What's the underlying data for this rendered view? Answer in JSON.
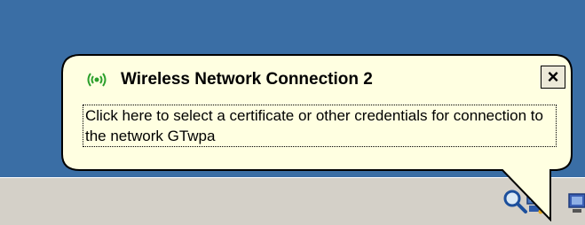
{
  "balloon": {
    "title": "Wireless Network Connection 2",
    "message": "Click here to select a certificate or other credentials for connection to the network GTwpa",
    "close_label": "×"
  },
  "icons": {
    "balloon_icon": "wireless-signal-icon",
    "tray": [
      "magnifier-icon",
      "network-computer-icon",
      "wireless-signal-icon",
      "monitor-icon"
    ]
  },
  "colors": {
    "desktop": "#3a6ea5",
    "taskbar": "#d4d0c8",
    "balloon_bg": "#ffffe1",
    "signal_green": "#2ca02c"
  }
}
